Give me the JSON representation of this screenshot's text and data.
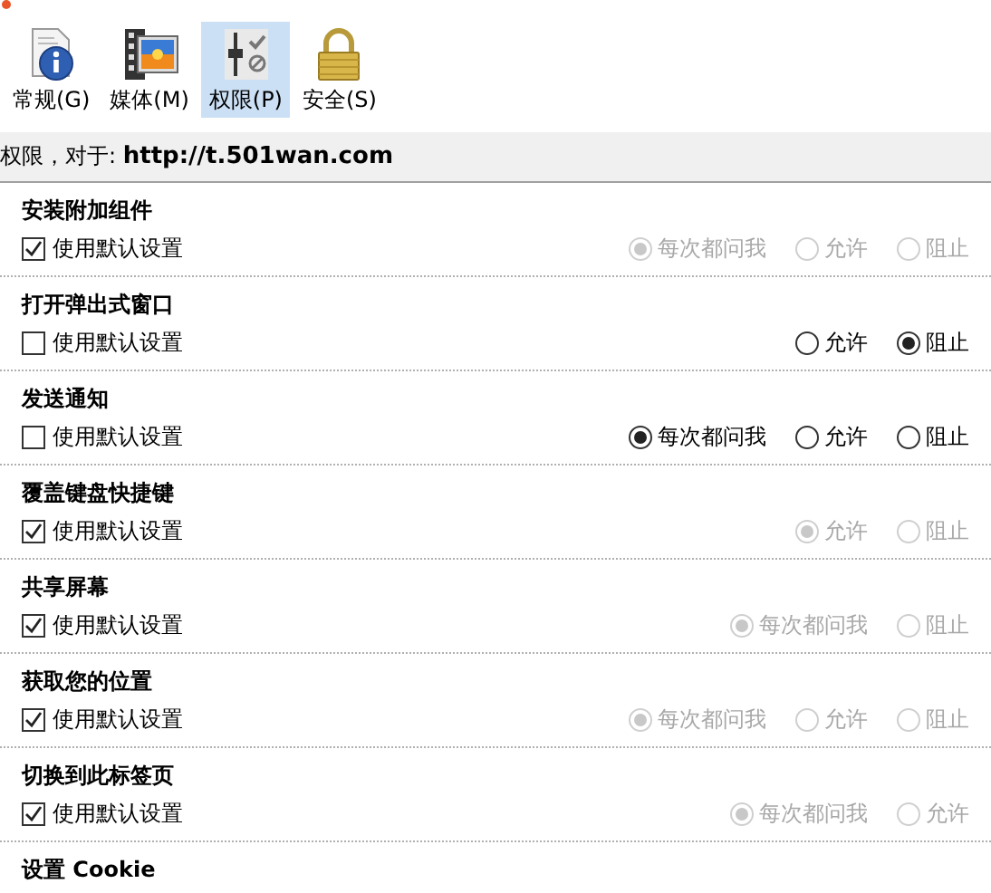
{
  "tabs": [
    {
      "label": "常规(G)",
      "kind": "info",
      "selected": false
    },
    {
      "label": "媒体(M)",
      "kind": "media",
      "selected": false
    },
    {
      "label": "权限(P)",
      "kind": "permissions",
      "selected": true
    },
    {
      "label": "安全(S)",
      "kind": "security",
      "selected": false
    }
  ],
  "header": {
    "prefix": "权限，对于: ",
    "site": "http://t.501wan.com"
  },
  "permissions": [
    {
      "title": "安装附加组件",
      "use_default_label": "使用默认设置",
      "use_default": true,
      "options": [
        {
          "label": "每次都问我",
          "selected": true
        },
        {
          "label": "允许",
          "selected": false
        },
        {
          "label": "阻止",
          "selected": false
        }
      ]
    },
    {
      "title": "打开弹出式窗口",
      "use_default_label": "使用默认设置",
      "use_default": false,
      "options": [
        {
          "label": "允许",
          "selected": false
        },
        {
          "label": "阻止",
          "selected": true
        }
      ]
    },
    {
      "title": "发送通知",
      "use_default_label": "使用默认设置",
      "use_default": false,
      "options": [
        {
          "label": "每次都问我",
          "selected": true
        },
        {
          "label": "允许",
          "selected": false
        },
        {
          "label": "阻止",
          "selected": false
        }
      ]
    },
    {
      "title": "覆盖键盘快捷键",
      "use_default_label": "使用默认设置",
      "use_default": true,
      "options": [
        {
          "label": "允许",
          "selected": true
        },
        {
          "label": "阻止",
          "selected": false
        }
      ]
    },
    {
      "title": "共享屏幕",
      "use_default_label": "使用默认设置",
      "use_default": true,
      "options": [
        {
          "label": "每次都问我",
          "selected": true
        },
        {
          "label": "阻止",
          "selected": false
        }
      ]
    },
    {
      "title": "获取您的位置",
      "use_default_label": "使用默认设置",
      "use_default": true,
      "options": [
        {
          "label": "每次都问我",
          "selected": true
        },
        {
          "label": "允许",
          "selected": false
        },
        {
          "label": "阻止",
          "selected": false
        }
      ]
    },
    {
      "title": "切换到此标签页",
      "use_default_label": "使用默认设置",
      "use_default": true,
      "options": [
        {
          "label": "每次都问我",
          "selected": true
        },
        {
          "label": "允许",
          "selected": false
        }
      ]
    },
    {
      "title": "设置 Cookie"
    }
  ]
}
